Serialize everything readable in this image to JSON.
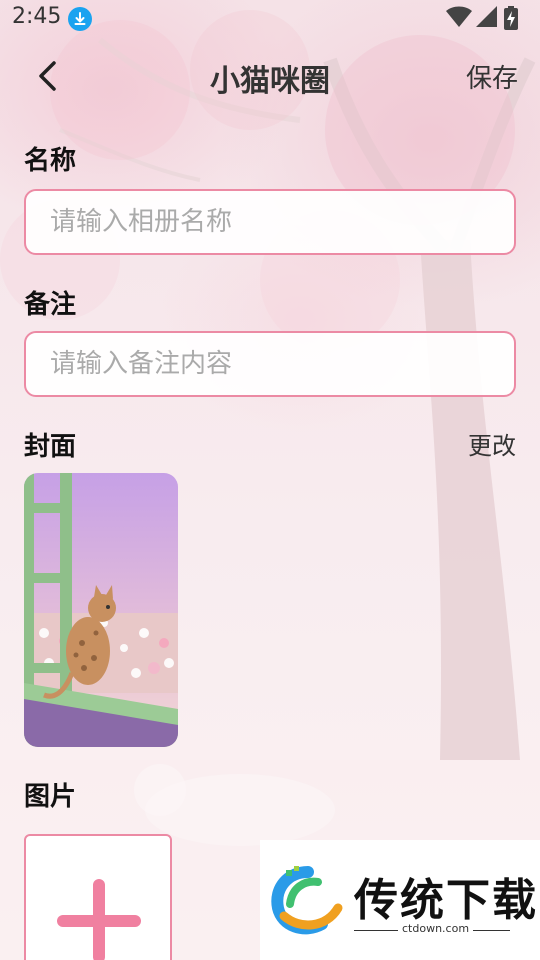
{
  "status_bar": {
    "time": "2:45"
  },
  "header": {
    "title": "小猫咪圈",
    "save_label": "保存"
  },
  "name_section": {
    "label": "名称",
    "placeholder": "请输入相册名称",
    "value": ""
  },
  "note_section": {
    "label": "备注",
    "placeholder": "请输入备注内容",
    "value": ""
  },
  "cover_section": {
    "label": "封面",
    "change_label": "更改"
  },
  "images_section": {
    "label": "图片"
  },
  "watermark": {
    "name": "传统下载",
    "url": "ctdown.com"
  },
  "colors": {
    "accent": "#ec8aa4",
    "add_plus": "#f080a0",
    "download_badge": "#1aa3f0"
  },
  "icons": {
    "back": "chevron-left-icon",
    "download": "download-icon",
    "wifi": "wifi-icon",
    "signal": "signal-icon",
    "battery": "battery-charging-icon",
    "add": "plus-icon"
  }
}
